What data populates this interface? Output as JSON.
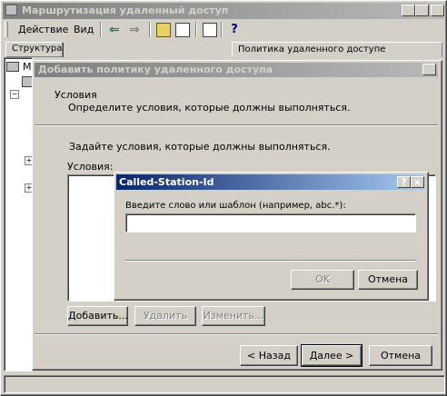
{
  "main_window": {
    "title": "Маршрутизация удаленный доступ",
    "menu": {
      "action": "Действие",
      "view": "Вид"
    },
    "tab_structure": "Структура",
    "column_header": "Политика удаленного доступе"
  },
  "policy_dialog": {
    "title": "Добавить политику удаленного доступа",
    "section_title": "Условия",
    "section_desc": "Определите условия, которые должны выполняться.",
    "instructions": "Задайте условия, которые должны выполняться.",
    "conditions_label": "Условия:",
    "add_button": "Добавить...",
    "remove_button": "Удалить",
    "edit_button": "Изменить...",
    "back_button": "< Назад",
    "next_button": "Далее >",
    "cancel_button": "Отмена"
  },
  "attr_dialog": {
    "title": "Called-Station-Id",
    "help_btn": "?",
    "close_btn": "×",
    "prompt": "Введите слово или шаблон (например, abc.*):",
    "input_value": "",
    "ok_button": "OK",
    "cancel_button": "Отмена"
  },
  "colors": {
    "face": "#d4d0c8",
    "active_title_start": "#0a246a",
    "active_title_end": "#a6caf0",
    "inactive_title_start": "#808080",
    "inactive_title_end": "#b8b8b8"
  }
}
